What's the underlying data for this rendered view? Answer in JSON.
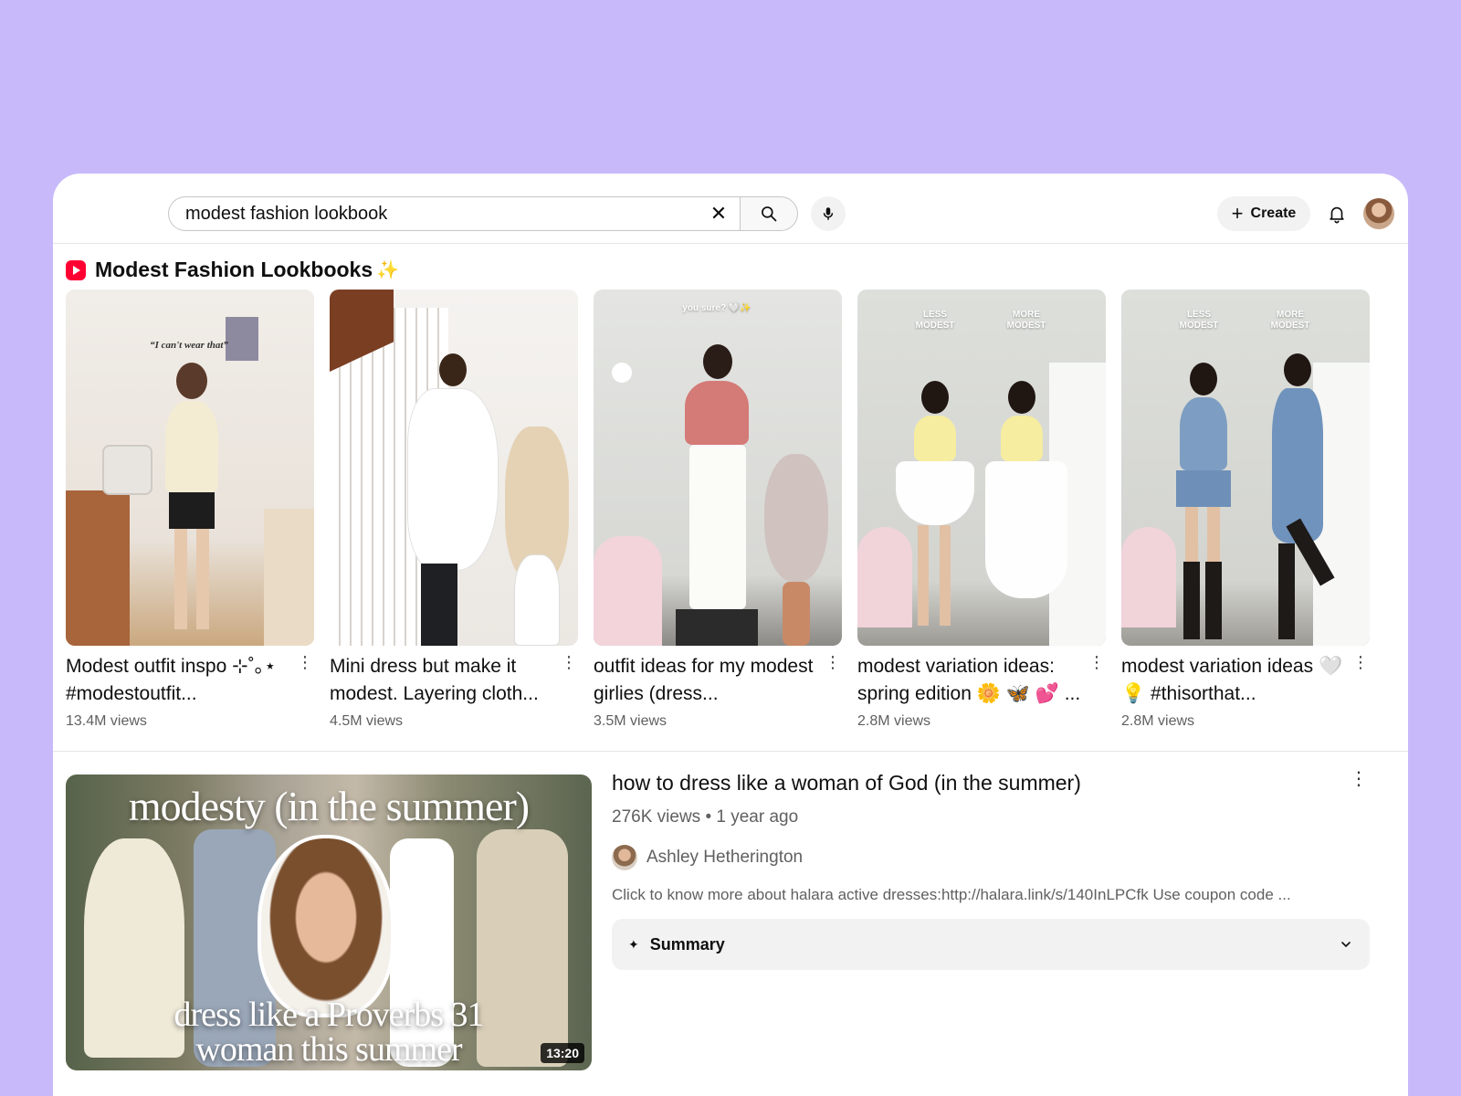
{
  "search": {
    "value": "modest fashion lookbook",
    "clear_label": "✕"
  },
  "header": {
    "create_label": "Create"
  },
  "shorts": {
    "section_title": "Modest Fashion Lookbooks",
    "items": [
      {
        "title": "Modest outfit inspo ⊹˚｡⋆ #modestoutfit...",
        "views": "13.4M views",
        "overlay": "“I can't wear that”"
      },
      {
        "title": "Mini dress but make it modest. Layering cloth...",
        "views": "4.5M views",
        "overlay": ""
      },
      {
        "title": "outfit ideas for my modest girlies (dress...",
        "views": "3.5M views",
        "overlay": "you sure? 🤍✨"
      },
      {
        "title": "modest variation ideas: spring edition 🌼 🦋 💕 ...",
        "views": "2.8M views",
        "overlay_left": "LESS MODEST",
        "overlay_right": "MORE MODEST"
      },
      {
        "title": "modest variation ideas 🤍 💡 #thisorthat...",
        "views": "2.8M views",
        "overlay_left": "LESS MODEST",
        "overlay_right": "MORE MODEST"
      }
    ]
  },
  "video": {
    "title": "how to dress like a woman of God (in the summer)",
    "meta": "276K views • 1 year ago",
    "channel": "Ashley Hetherington",
    "description": "Click to know more about halara active dresses:http://halara.link/s/140InLPCfk Use coupon code ...",
    "summary_label": "Summary",
    "duration": "13:20",
    "thumb_title_top": "modesty (in the summer)",
    "thumb_title_bottom_1": "dress like a Proverbs 31",
    "thumb_title_bottom_2": "woman this summer"
  },
  "icons": {
    "search": "search-icon",
    "mic": "mic-icon",
    "bell": "bell-icon",
    "more": "more-vert-icon",
    "chevron": "chevron-down-icon"
  },
  "colors": {
    "background": "#c8b9fb",
    "shorts_red": "#ff0033"
  }
}
